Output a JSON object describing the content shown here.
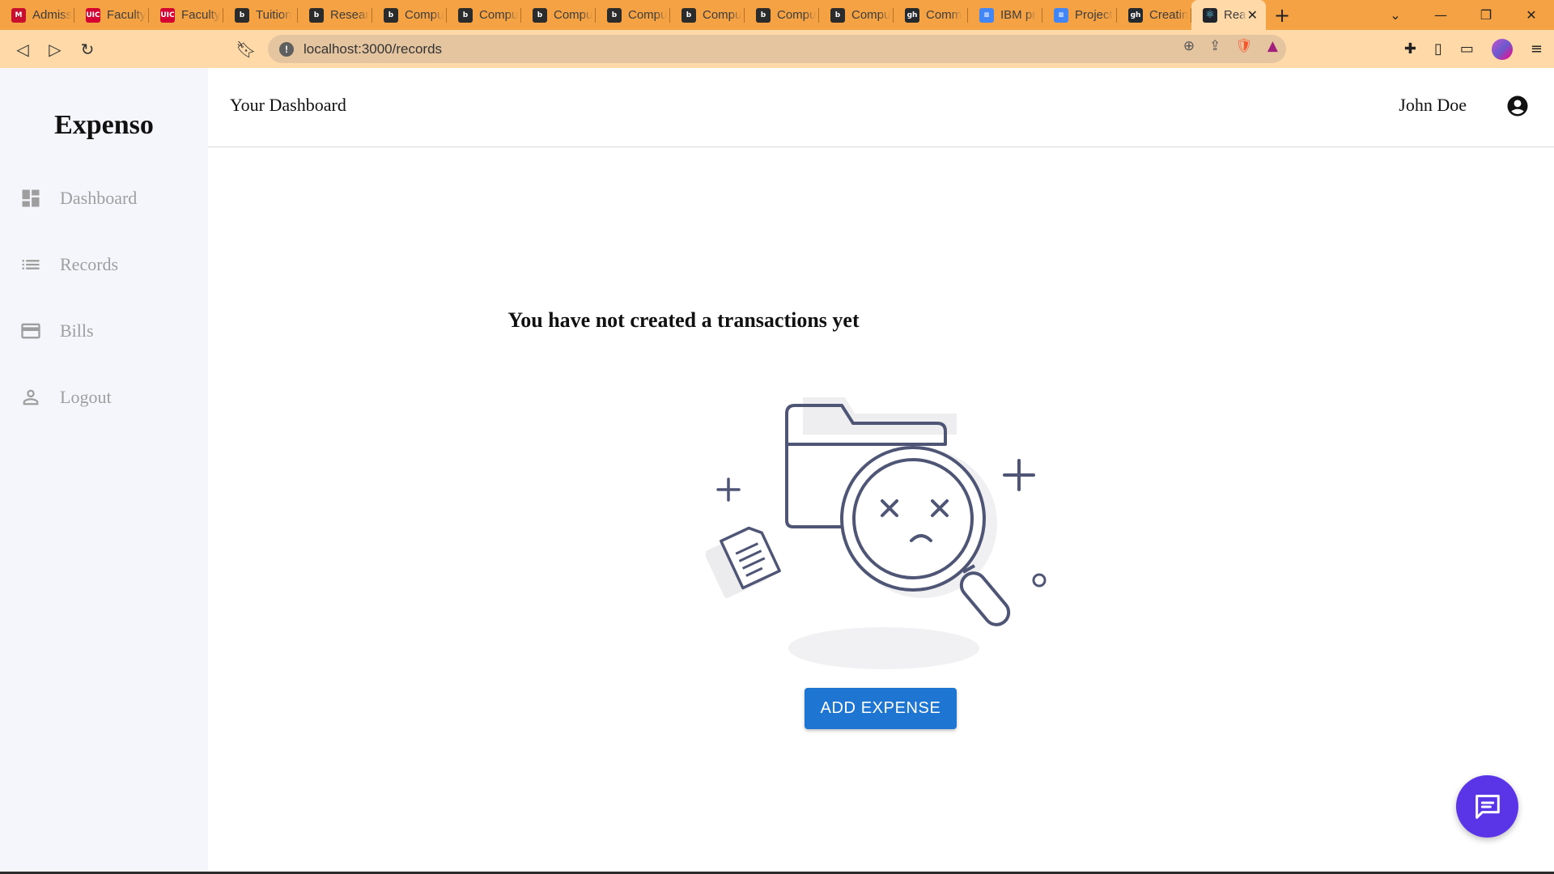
{
  "browser": {
    "tabs": [
      {
        "title": "Admiss",
        "favicon_color": "#c8102e",
        "favicon_text": "M"
      },
      {
        "title": "Faculty",
        "favicon_color": "#d50032",
        "favicon_text": "UIC"
      },
      {
        "title": "Faculty",
        "favicon_color": "#d50032",
        "favicon_text": "UIC"
      },
      {
        "title": "Tuition",
        "favicon_color": "#2b2b2b",
        "favicon_text": "b"
      },
      {
        "title": "Resear",
        "favicon_color": "#2b2b2b",
        "favicon_text": "b"
      },
      {
        "title": "Compu",
        "favicon_color": "#2b2b2b",
        "favicon_text": "b"
      },
      {
        "title": "Compu",
        "favicon_color": "#2b2b2b",
        "favicon_text": "b"
      },
      {
        "title": "Compu",
        "favicon_color": "#2b2b2b",
        "favicon_text": "b"
      },
      {
        "title": "Compu",
        "favicon_color": "#2b2b2b",
        "favicon_text": "b"
      },
      {
        "title": "Compu",
        "favicon_color": "#2b2b2b",
        "favicon_text": "b"
      },
      {
        "title": "Compu",
        "favicon_color": "#2b2b2b",
        "favicon_text": "b"
      },
      {
        "title": "Compu",
        "favicon_color": "#2b2b2b",
        "favicon_text": "b"
      },
      {
        "title": "Comm",
        "favicon_color": "#24292e",
        "favicon_text": "gh"
      },
      {
        "title": "IBM pr",
        "favicon_color": "#4285f4",
        "favicon_text": "≡"
      },
      {
        "title": "Project",
        "favicon_color": "#4285f4",
        "favicon_text": "≡"
      },
      {
        "title": "Creatin",
        "favicon_color": "#24292e",
        "favicon_text": "gh"
      }
    ],
    "active_tab": {
      "title": "Rea",
      "favicon_color": "#20232a",
      "favicon_text": "⚛"
    },
    "url": "localhost:3000/records"
  },
  "sidebar": {
    "brand": "Expenso",
    "items": [
      {
        "label": "Dashboard",
        "icon": "dashboard-icon"
      },
      {
        "label": "Records",
        "icon": "list-icon"
      },
      {
        "label": "Bills",
        "icon": "credit-card-icon"
      },
      {
        "label": "Logout",
        "icon": "person-icon"
      }
    ]
  },
  "header": {
    "title": "Your Dashboard",
    "user_name": "John Doe"
  },
  "main": {
    "empty_message": "You have not created a transactions yet",
    "add_button_label": "ADD EXPENSE"
  },
  "colors": {
    "tabstrip": "#f5a244",
    "toolbar": "#ffd9a8",
    "sidebar_bg": "#f5f6fb",
    "primary_button": "#1f76d2",
    "chat_fab": "#5a35e8",
    "illustration_stroke": "#4f5575"
  }
}
